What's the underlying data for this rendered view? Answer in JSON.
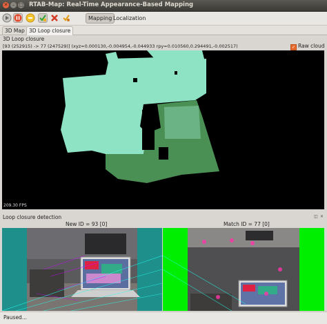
{
  "window": {
    "title": "RTAB-Map: Real-Time Appearance-Based Mapping",
    "buttons": [
      "close-icon",
      "minimize-icon",
      "maximize-icon"
    ]
  },
  "toolbar": {
    "icons": [
      "play-icon",
      "stop-icon",
      "pause-icon",
      "add-check-icon",
      "delete-icon",
      "trigger-icon"
    ],
    "mode_mapping": "Mapping",
    "mode_localization": "Localization",
    "mapping_checked": true
  },
  "tabs": [
    {
      "label": "3D Map",
      "active": false
    },
    {
      "label": "3D Loop closure",
      "active": true
    }
  ],
  "loop_view": {
    "title": "3D Loop closure",
    "info": "[93 (252915) -> 77 (247529)]  (xyz=0.000130,-0.004954,-0.044933  rpy=0.010560,0.294491,-0.002517)",
    "raw_cloud_label": "Raw  cloud",
    "raw_cloud_checked": true,
    "fps": "209.30 FPS",
    "cloud_colors": {
      "new": "#8fe3c5",
      "matched": "#4a8f54",
      "background": "#000000"
    }
  },
  "loop_detection": {
    "title": "Loop closure detection",
    "new_id_label": "New ID = 93 [0]",
    "match_id_label": "Match ID = 77 [0]",
    "new_border_color": "#1e8f8a",
    "match_border_color": "#00ee00"
  },
  "status": {
    "text": "Paused..."
  }
}
